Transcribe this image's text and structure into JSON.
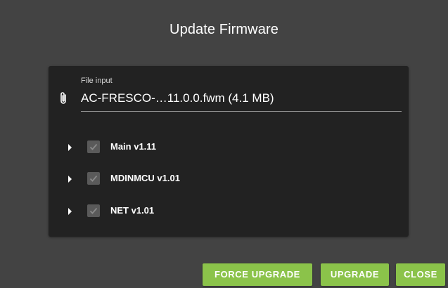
{
  "dialog": {
    "title": "Update Firmware"
  },
  "file_input": {
    "label": "File input",
    "value": "AC-FRESCO-…11.0.0.fwm (4.1 MB)",
    "icon": "paperclip-icon"
  },
  "components": [
    {
      "label": "Main v1.11",
      "checked": true
    },
    {
      "label": "MDINMCU v1.01",
      "checked": true
    },
    {
      "label": "NET v1.01",
      "checked": true
    }
  ],
  "buttons": {
    "force_upgrade": "FORCE UPGRADE",
    "upgrade": "UPGRADE",
    "close": "CLOSE"
  },
  "colors": {
    "accent": "#8bc34a",
    "dialog_bg": "#434343",
    "card_bg": "#222222"
  }
}
